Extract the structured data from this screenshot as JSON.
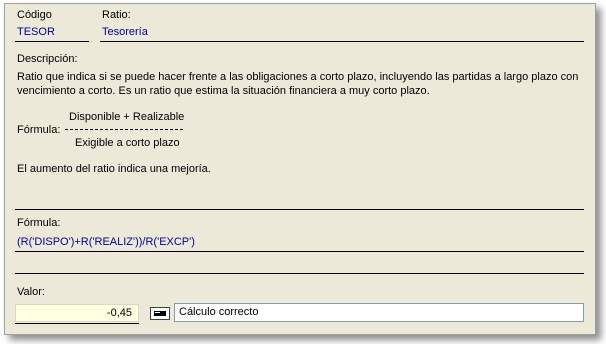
{
  "header": {
    "codigo_label": "Código",
    "codigo_value": "TESOR",
    "ratio_label": "Ratio:",
    "ratio_value": "Tesorería"
  },
  "descripcion": {
    "label": "Descripción:",
    "line1": "Ratio que indica si se puede hacer frente a las obligaciones a corto plazo, incluyendo las partidas a largo plazo con",
    "line2": "vencimiento a corto. Es un ratio que estima la situación financiera a muy corto plazo.",
    "formula_label": "Fórmula:",
    "numerator": "Disponible + Realizable",
    "denominator": "Exigible a corto plazo",
    "note": "El aumento del ratio indica una mejoría."
  },
  "formula": {
    "label": "Fórmula:",
    "expression": "(R('DISPO')+R('REALIZ'))/R('EXCP')"
  },
  "valor": {
    "label": "Valor:",
    "value": "-0,45",
    "status": "Cálculo correcto"
  }
}
